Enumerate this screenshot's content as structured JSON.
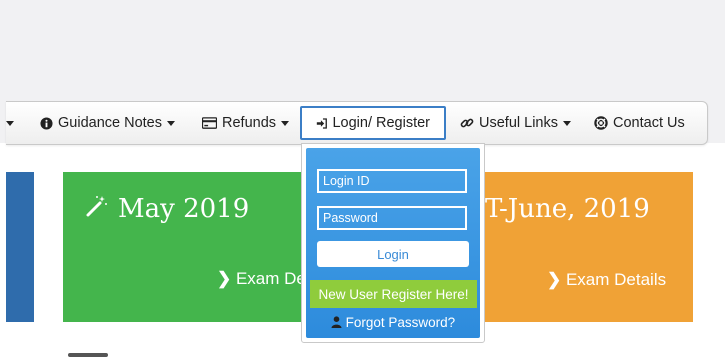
{
  "nav": {
    "items": [
      {
        "label": "Guidance Notes",
        "icon": "info-circle-icon",
        "has_caret": true
      },
      {
        "label": "Refunds",
        "icon": "credit-card-icon",
        "has_caret": true
      },
      {
        "label": "Login/ Register",
        "icon": "sign-in-icon",
        "has_caret": false,
        "active": true
      },
      {
        "label": "Useful Links",
        "icon": "link-icon",
        "has_caret": true
      },
      {
        "label": "Contact Us",
        "icon": "life-ring-icon",
        "has_caret": false
      }
    ]
  },
  "cards": {
    "green": {
      "title": "May 2019",
      "link": "Exam De",
      "icon": "magic-wand-icon",
      "color": "#44b54c"
    },
    "orange": {
      "title": "T-June, 2019",
      "link": "Exam Details",
      "color": "#f0a236"
    },
    "left_strip_color": "#2f6cac"
  },
  "login": {
    "login_id_placeholder": "Login ID",
    "password_placeholder": "Password",
    "login_button": "Login",
    "register_button": "New User Register Here!",
    "forgot_password": "Forgot Password?",
    "panel_color": "#2d8bdc",
    "register_color": "#8fcc3c"
  },
  "accent_color": "#3b7ec6"
}
